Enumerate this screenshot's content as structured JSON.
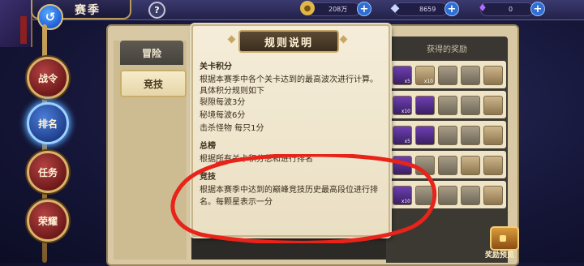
{
  "header": {
    "title": "赛季",
    "help": "?",
    "back": "↺"
  },
  "currencies": [
    {
      "icon": "gold-coin-icon",
      "value": "208万",
      "color": "#e0b84a"
    },
    {
      "icon": "diamond-icon",
      "value": "8659",
      "color": "#c9d6ff"
    },
    {
      "icon": "crystal-icon",
      "value": "0",
      "color": "#b46bff"
    }
  ],
  "side_nav": [
    {
      "label": "战令",
      "active": false
    },
    {
      "label": "排名",
      "active": true
    },
    {
      "label": "任务",
      "active": false
    },
    {
      "label": "荣耀",
      "active": false
    }
  ],
  "tabs": [
    {
      "label": "冒险"
    },
    {
      "label": "竞技"
    }
  ],
  "rewards": {
    "header": "获得的奖励",
    "preview_label": "奖励预览",
    "row_count_labels": [
      "x5",
      "x10",
      "x10",
      "x5",
      "x10"
    ]
  },
  "modal": {
    "title": "规则说明",
    "sections": [
      {
        "heading": "关卡积分",
        "lines": [
          "根据本赛季中各个关卡达到的最高波次进行计算。",
          "具体积分规则如下",
          "裂隙每波3分",
          "秘境每波6分",
          "击杀怪物  每只1分"
        ]
      },
      {
        "heading": "总榜",
        "lines": [
          "根据所有关卡积分总和进行排名"
        ]
      },
      {
        "heading": "竞技",
        "lines": [
          "根据本赛季中达到的巅峰竞技历史最高段位进行排名。每颗星表示一分"
        ]
      }
    ]
  },
  "colors": {
    "marker": "#e8231a",
    "modal_bg": "#f3ead4",
    "header_bg": "#4a3a28"
  }
}
